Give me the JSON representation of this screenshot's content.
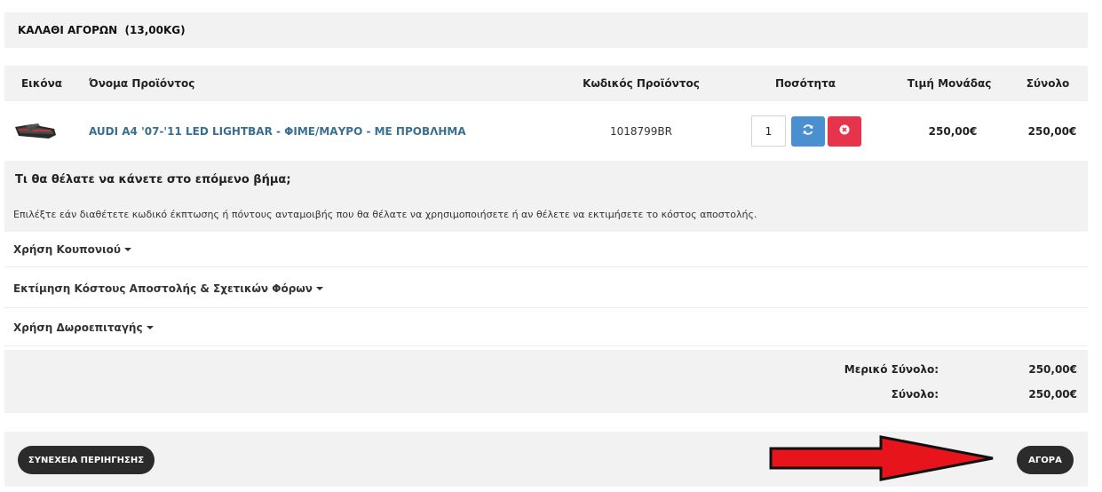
{
  "cart": {
    "title": "ΚΑΛΑΘΙ ΑΓΟΡΩΝ  (13,00KG)"
  },
  "table": {
    "headers": {
      "image": "Εικόνα",
      "name": "Όνομα Προϊόντος",
      "code": "Κωδικός Προϊόντος",
      "quantity": "Ποσότητα",
      "unit_price": "Τιμή Μονάδας",
      "total": "Σύνολο"
    },
    "rows": [
      {
        "name": "AUDI A4 '07-'11 LED LIGHTBAR - ΦΙΜΕ/ΜΑΥΡΟ - ΜΕ ΠΡΟΒΛΗΜΑ",
        "code": "1018799BR",
        "quantity": "1",
        "unit_price": "250,00€",
        "total": "250,00€"
      }
    ]
  },
  "next_step": {
    "title": "Τι θα θέλατε να κάνετε στο επόμενο βήμα;",
    "description": "Επιλέξτε εάν διαθέτετε κωδικό έκπτωσης ή πόντους ανταμοιβής που θα θέλατε να χρησιμοποιήσετε ή αν θέλετε να εκτιμήσετε το κόστος αποστολής."
  },
  "accordions": [
    {
      "label": "Χρήση Κουπονιού"
    },
    {
      "label": "Εκτίμηση Κόστους Αποστολής & Σχετικών Φόρων"
    },
    {
      "label": "Χρήση Δωροεπιταγής"
    }
  ],
  "totals": {
    "subtotal_label": "Μερικό Σύνολο:",
    "subtotal_value": "250,00€",
    "total_label": "Σύνολο:",
    "total_value": "250,00€"
  },
  "buttons": {
    "continue": "ΣΥΝΕΧΕΙΑ ΠΕΡΙΗΓΗΣΗΣ",
    "buy": "ΑΓΟΡΑ"
  },
  "colors": {
    "accent_link": "#3a6f8f",
    "refresh_button": "#4a8fd0",
    "remove_button": "#e7344d",
    "arrow": "#e8141c",
    "pill_button": "#2b2b2b"
  },
  "icons": {
    "refresh": "refresh-icon",
    "remove": "close-circle-icon",
    "caret": "caret-down-icon",
    "arrow": "arrow-right-icon"
  }
}
